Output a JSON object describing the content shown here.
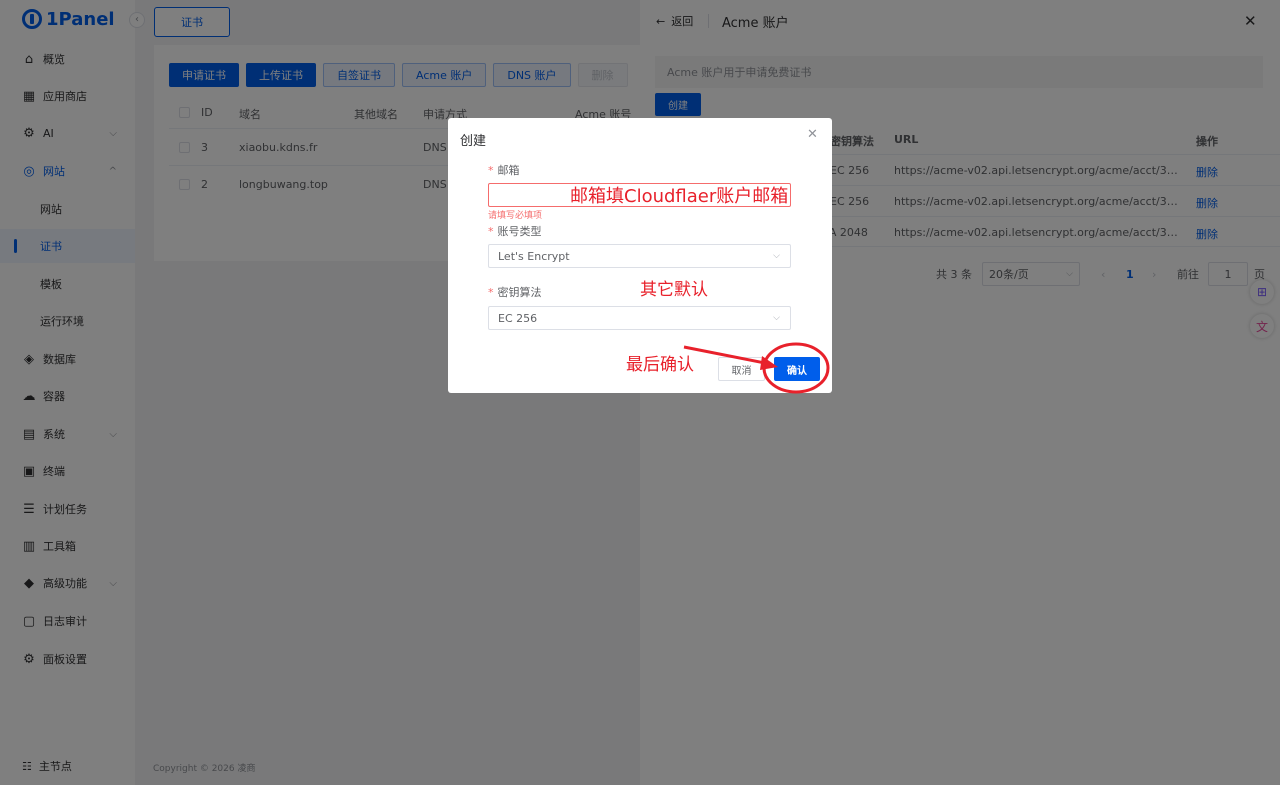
{
  "brand": {
    "logo_text": "1Panel",
    "primary_color": "#005eeb",
    "danger_color": "#f56c6c",
    "annotation_color": "#e8212b"
  },
  "sidebar": {
    "collapse_icon": "‹",
    "items": [
      {
        "icon": "⌂",
        "label": "概览"
      },
      {
        "icon": "▦",
        "label": "应用商店"
      },
      {
        "icon": "⚙",
        "label": "AI"
      },
      {
        "icon": "◎",
        "label": "网站"
      },
      {
        "label": "网站"
      },
      {
        "label": "证书"
      },
      {
        "label": "模板"
      },
      {
        "label": "运行环境"
      },
      {
        "icon": "◈",
        "label": "数据库"
      },
      {
        "icon": "☁",
        "label": "容器"
      },
      {
        "icon": "▤",
        "label": "系统"
      },
      {
        "icon": "▣",
        "label": "终端"
      },
      {
        "icon": "☰",
        "label": "计划任务"
      },
      {
        "icon": "▥",
        "label": "工具箱"
      },
      {
        "icon": "◆",
        "label": "高级功能"
      },
      {
        "icon": "▢",
        "label": "日志审计"
      },
      {
        "icon": "⚙",
        "label": "面板设置"
      }
    ],
    "node": {
      "icon": "☷",
      "label": "主节点"
    }
  },
  "main": {
    "tab": "证书",
    "toolbar": [
      "申请证书",
      "上传证书",
      "自签证书",
      "Acme 账户",
      "DNS 账户",
      "删除"
    ],
    "columns": [
      "ID",
      "域名",
      "其他域名",
      "申请方式",
      "Acme 账号"
    ],
    "rows": [
      {
        "id": "3",
        "domain": "xiaobu.kdns.fr",
        "method": "DNS"
      },
      {
        "id": "2",
        "domain": "longbuwang.top",
        "method": "DNS"
      }
    ],
    "copyright": "Copyright © 2026 凌商"
  },
  "drawer": {
    "back_label": "返回",
    "title": "Acme 账户",
    "tip": "Acme 账户用于申请免费证书",
    "create_label": "创建",
    "columns": {
      "key_algo": "密钥算法",
      "url": "URL",
      "actions": "操作"
    },
    "rows": [
      {
        "key_algo": "EC 256",
        "url": "https://acme-v02.api.letsencrypt.org/acme/acct/3…",
        "action": "删除"
      },
      {
        "key_algo": "EC 256",
        "url": "https://acme-v02.api.letsencrypt.org/acme/acct/3…",
        "action": "删除"
      },
      {
        "key_algo": "RSA 2048",
        "url": "https://acme-v02.api.letsencrypt.org/acme/acct/3…",
        "action": "删除"
      }
    ],
    "pager": {
      "total": "共 3 条",
      "page_size": "20条/页",
      "current": "1",
      "goto_label": "前往",
      "goto_value": "1",
      "page_unit": "页"
    }
  },
  "dialog": {
    "title": "创建",
    "email": {
      "label": "邮箱",
      "value": "",
      "error": "请填写必填项"
    },
    "account_type": {
      "label": "账号类型",
      "value": "Let's Encrypt"
    },
    "key_algo": {
      "label": "密钥算法",
      "value": "EC 256"
    },
    "cancel_label": "取消",
    "confirm_label": "确认"
  },
  "annotations": {
    "email_note": "邮箱填Cloudflaer账户邮箱",
    "default_note": "其它默认",
    "confirm_note": "最后确认"
  }
}
